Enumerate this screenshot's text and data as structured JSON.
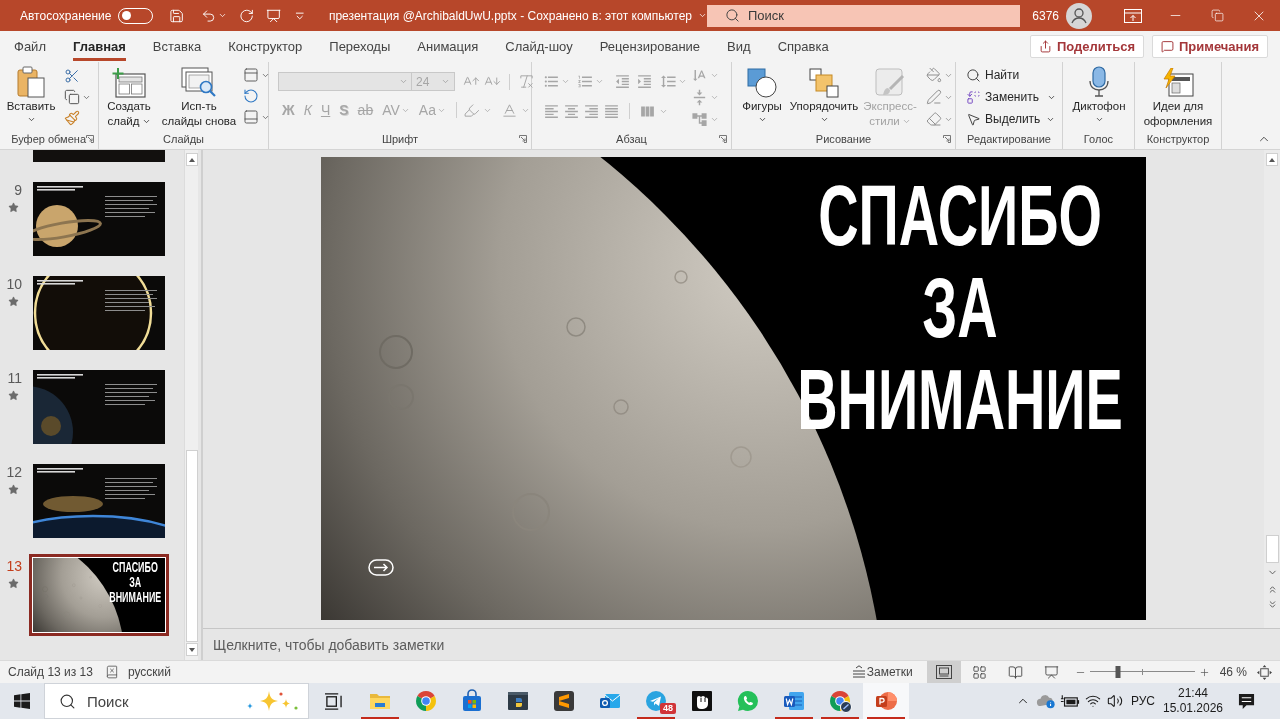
{
  "title_bar": {
    "autosave_label": "Автосохранение",
    "autosave_on": false,
    "document_title": "презентация @ArchibaldUwU.pptx - Сохранено в: этот компьютер",
    "search_placeholder": "Поиск",
    "account_number": "6376"
  },
  "ribbon_tabs": [
    {
      "label": "Файл",
      "selected": false
    },
    {
      "label": "Главная",
      "selected": true
    },
    {
      "label": "Вставка",
      "selected": false
    },
    {
      "label": "Конструктор",
      "selected": false
    },
    {
      "label": "Переходы",
      "selected": false
    },
    {
      "label": "Анимация",
      "selected": false
    },
    {
      "label": "Слайд-шоу",
      "selected": false
    },
    {
      "label": "Рецензирование",
      "selected": false
    },
    {
      "label": "Вид",
      "selected": false
    },
    {
      "label": "Справка",
      "selected": false
    }
  ],
  "header_buttons": {
    "share": "Поделиться",
    "comments": "Примечания"
  },
  "ribbon": {
    "clipboard": {
      "label": "Буфер обмена",
      "paste": "Вставить"
    },
    "slides": {
      "label": "Слайды",
      "new_slide": [
        "Создать",
        "слайд"
      ],
      "reuse_slides": [
        "Исп-ть",
        "слайды снова"
      ]
    },
    "font": {
      "label": "Шрифт",
      "disabled": true,
      "font_size": "24",
      "format_buttons": [
        {
          "kind": "bold",
          "label": "Ж"
        },
        {
          "kind": "italic",
          "label": "К"
        },
        {
          "kind": "underline",
          "label": "Ч"
        },
        {
          "kind": "shadow",
          "label": "S"
        },
        {
          "kind": "strikethrough",
          "label": "ab"
        },
        {
          "kind": "spacing",
          "label": "AV"
        },
        {
          "kind": "case",
          "label": "Aa"
        }
      ]
    },
    "paragraph": {
      "label": "Абзац",
      "disabled": true
    },
    "drawing": {
      "label": "Рисование",
      "shapes": "Фигуры",
      "arrange": "Упорядочить",
      "quick_styles": "Экспресс-стили",
      "quick_styles_disabled": true
    },
    "editing": {
      "label": "Редактирование",
      "find": "Найти",
      "replace": "Заменить",
      "select": "Выделить"
    },
    "voice": {
      "label": "Голос",
      "dictate": "Диктофон"
    },
    "designer": {
      "label": "Конструктор",
      "design_ideas": [
        "Идеи для",
        "оформления"
      ]
    }
  },
  "slide_thumbnails": [
    {
      "number": "9",
      "selected": false
    },
    {
      "number": "10",
      "selected": false
    },
    {
      "number": "11",
      "selected": false
    },
    {
      "number": "12",
      "selected": false
    },
    {
      "number": "13",
      "selected": true,
      "title": "СПАСИБО ЗА ВНИМАНИЕ"
    }
  ],
  "slide": {
    "title": "СПАСИБО ЗА ВНИМАНИЕ"
  },
  "notes": {
    "placeholder": "Щелкните, чтобы добавить заметки"
  },
  "status_bar": {
    "slide_counter": "Слайд 13 из 13",
    "language": "русский",
    "notes_button": "Заметки",
    "views": [
      {
        "selected": true
      },
      {
        "selected": false
      },
      {
        "selected": false
      },
      {
        "selected": false
      }
    ],
    "zoom": {
      "level": 0.27
    },
    "zoom_reading": "46 %"
  },
  "taskbar": {
    "search_placeholder": "Поиск",
    "apps": [
      {
        "running": true,
        "selected": false
      },
      {
        "running": false,
        "selected": false
      },
      {
        "running": false,
        "selected": false
      },
      {
        "running": false,
        "selected": false
      },
      {
        "running": false,
        "selected": false
      },
      {
        "running": false,
        "selected": false
      },
      {
        "running": true,
        "selected": false,
        "badge": "48"
      },
      {
        "running": false,
        "selected": false
      },
      {
        "running": false,
        "selected": false
      },
      {
        "running": true,
        "selected": false
      },
      {
        "running": true,
        "selected": false
      },
      {
        "running": true,
        "selected": true
      }
    ],
    "keyboard_language": "РУС",
    "time": "21:44",
    "date": "15.01.2026"
  }
}
